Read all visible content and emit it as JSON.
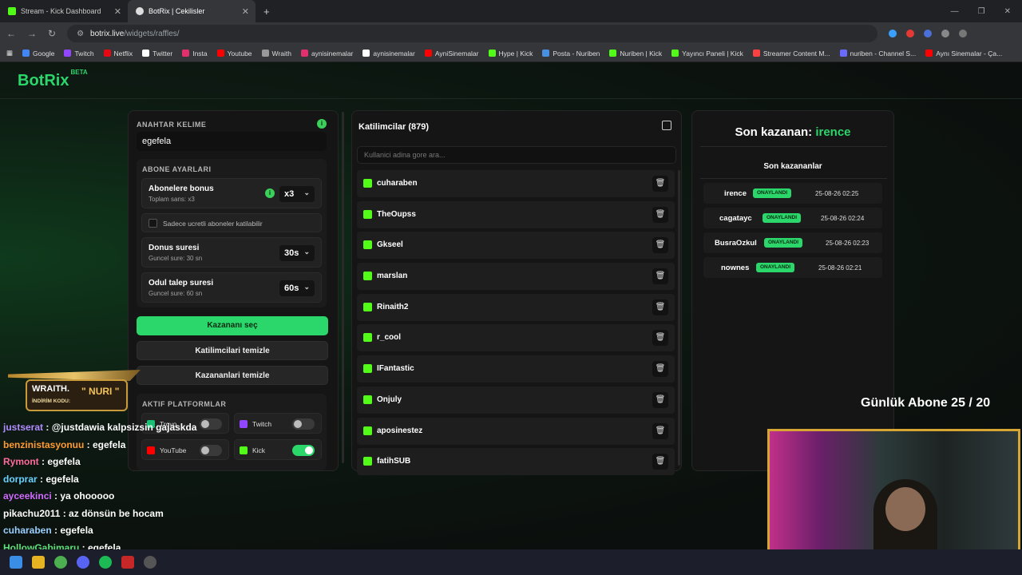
{
  "browser": {
    "tabs": [
      {
        "label": "Stream - Kick Dashboard",
        "active": false
      },
      {
        "label": "BotRix | Cekilisler",
        "active": true
      }
    ],
    "url_host": "botrix.live",
    "url_path": "/widgets/raffles/",
    "bookmarks": [
      "Google",
      "Twitch",
      "Netflix",
      "Twitter",
      "Insta",
      "Youtube",
      "Wraith",
      "aynisinemalar",
      "aynisinemalar",
      "AyniSinemalar",
      "Hype | Kick",
      "Posta - Nuriben",
      "Nuriben | Kick",
      "Yayıncı Paneli | Kick",
      "Streamer Content M...",
      "nuriben - Channel S...",
      "Aynı Sinemalar - Ça..."
    ]
  },
  "app": {
    "logo": "BotRix",
    "beta": "BETA"
  },
  "left": {
    "keyword_label": "ANAHTAR KELIME",
    "keyword_value": "egefela",
    "sub_label": "ABONE AYARLARI",
    "bonus_title": "Abonelere bonus",
    "bonus_sub": "Toplam sans: x3",
    "bonus_value": "x3",
    "paid_only": "Sadece ucretli aboneler katilabilir",
    "donus_title": "Donus suresi",
    "donus_sub": "Guncel sure: 30 sn",
    "donus_value": "30s",
    "odul_title": "Odul talep suresi",
    "odul_sub": "Guncel sure: 60 sn",
    "odul_value": "60s",
    "pick_btn": "Kazananı seç",
    "clear_participants": "Katilimcilari temizle",
    "clear_winners": "Kazananlari temizle",
    "platforms_label": "AKTIF PLATFORMLAR",
    "platforms": [
      {
        "name": "Trovo",
        "on": false
      },
      {
        "name": "Twitch",
        "on": false
      },
      {
        "name": "YouTube",
        "on": false
      },
      {
        "name": "Kick",
        "on": true
      }
    ]
  },
  "participants": {
    "title": "Katilimcilar (879)",
    "search_placeholder": "Kullanici adina gore ara...",
    "items": [
      "cuharaben",
      "TheOupss",
      "Gkseel",
      "marslan",
      "Rinaith2",
      "r_cool",
      "IFantastic",
      "Onjuly",
      "aposinestez",
      "fatihSUB"
    ]
  },
  "winners": {
    "last_label": "Son kazanan:",
    "last_name": "irence",
    "list_title": "Son kazananlar",
    "items": [
      {
        "name": "irence",
        "badge": "ONAYLANDI",
        "date": "25-08-26 02:25"
      },
      {
        "name": "cagatayc",
        "badge": "ONAYLANDI",
        "date": "25-08-26 02:24"
      },
      {
        "name": "BusraOzkul",
        "badge": "ONAYLANDI",
        "date": "25-08-26 02:23"
      },
      {
        "name": "nownes",
        "badge": "ONAYLANDI",
        "date": "25-08-26 02:21"
      }
    ]
  },
  "overlay": {
    "daily_sub": "Günlük Abone 25 / 20",
    "wraith": "WRAITH.",
    "promo": "İNDİRİM KODU:",
    "code": "\" NURI \""
  },
  "chat": [
    {
      "user": "justserat",
      "color": "#b28cff",
      "msg": " : @justdawia kalpsizsin gajaskda"
    },
    {
      "user": "benzinistasyonuu",
      "color": "#ff9b2f",
      "msg": " : egefela"
    },
    {
      "user": "Rymont",
      "color": "#ff6b9a",
      "msg": " : egefela"
    },
    {
      "user": "dorprar",
      "color": "#6ad2ff",
      "msg": " : egefela"
    },
    {
      "user": "ayceekinci",
      "color": "#d06bff",
      "msg": " : ya ohooooo"
    },
    {
      "user": "pikachu2011",
      "color": "#ffffff",
      "msg": " : az dönsün be hocam"
    },
    {
      "user": "cuharaben",
      "color": "#9ad0ff",
      "msg": " : egefela"
    },
    {
      "user": "HollowGabimaru",
      "color": "#5fe07a",
      "msg": " : egefela"
    }
  ]
}
